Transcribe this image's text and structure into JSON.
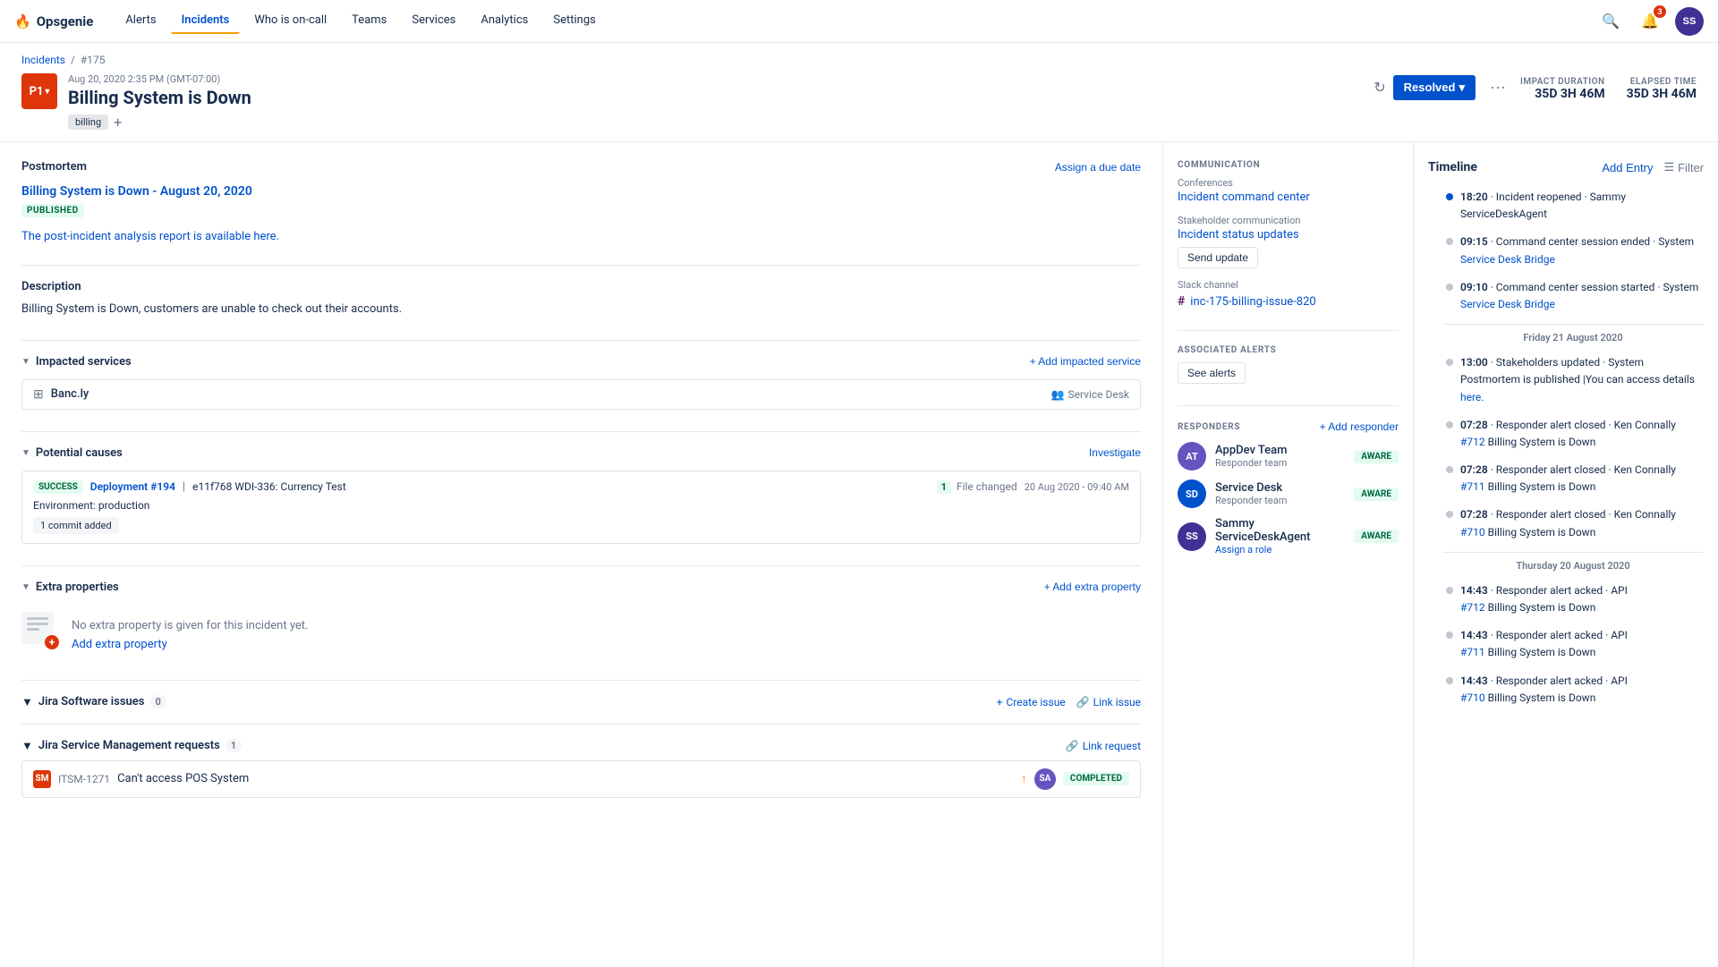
{
  "app": {
    "logo": "🔥",
    "name": "Opsgenie"
  },
  "nav": {
    "links": [
      {
        "label": "Alerts",
        "active": false
      },
      {
        "label": "Incidents",
        "active": true
      },
      {
        "label": "Who is on-call",
        "active": false
      },
      {
        "label": "Teams",
        "active": false
      },
      {
        "label": "Services",
        "active": false
      },
      {
        "label": "Analytics",
        "active": false
      },
      {
        "label": "Settings",
        "active": false
      }
    ],
    "notification_count": "3",
    "avatar_initials": "SS"
  },
  "breadcrumb": {
    "parent": "Incidents",
    "current": "#175"
  },
  "incident": {
    "priority": "P1",
    "date": "Aug 20, 2020 2:35 PM (GMT-07:00)",
    "title": "Billing System is Down",
    "tag": "billing",
    "status": "Resolved",
    "impact_duration_label": "IMPACT DURATION",
    "impact_duration": "35D 3H 46M",
    "elapsed_time_label": "ELAPSED TIME",
    "elapsed_time": "35D 3H 46M"
  },
  "postmortem": {
    "section_title": "Postmortem",
    "assign_due": "Assign a due date",
    "link_text": "Billing System is Down - August 20, 2020",
    "published_badge": "PUBLISHED",
    "description": "The post-incident analysis report is available here."
  },
  "description": {
    "section_title": "Description",
    "text": "Billing System is Down, customers are unable to check out their accounts."
  },
  "impacted_services": {
    "section_title": "Impacted services",
    "add_label": "+ Add impacted service",
    "services": [
      {
        "name": "Banc.ly",
        "team": "Service Desk"
      }
    ]
  },
  "potential_causes": {
    "section_title": "Potential causes",
    "investigate_label": "Investigate",
    "causes": [
      {
        "status": "SUCCESS",
        "deployment": "Deployment #194",
        "description": "e11f768 WDI-336: Currency Test",
        "file_count": "1",
        "file_changed": "File changed",
        "date": "20 Aug 2020 - 09:40 AM",
        "environment": "production",
        "commit": "1 commit added"
      }
    ]
  },
  "extra_properties": {
    "section_title": "Extra properties",
    "add_label": "+ Add extra property",
    "placeholder_text": "No extra property is given for this incident yet.",
    "add_inline": "Add extra property"
  },
  "jira_issues": {
    "section_title": "Jira Software issues",
    "count": "0",
    "create_label": "Create issue",
    "link_label": "Link issue"
  },
  "jira_service_mgmt": {
    "section_title": "Jira Service Management requests",
    "count": "1",
    "link_label": "Link request",
    "requests": [
      {
        "key": "ITSM-1271",
        "title": "Can't access POS System",
        "status": "COMPLETED",
        "priority": "↑"
      }
    ]
  },
  "communication": {
    "label": "COMMUNICATION",
    "conferences_label": "Conferences",
    "conference_link": "Incident command center",
    "stakeholder_label": "Stakeholder communication",
    "stakeholder_link": "Incident status updates",
    "send_update": "Send update",
    "slack_label": "Slack channel",
    "slack_channel": "inc-175-billing-issue-820"
  },
  "associated_alerts": {
    "label": "ASSOCIATED ALERTS",
    "see_alerts": "See alerts"
  },
  "responders": {
    "label": "RESPONDERS",
    "add_label": "+ Add responder",
    "list": [
      {
        "initials": "AT",
        "name": "AppDev Team",
        "role": "Responder team",
        "status": "AWARE"
      },
      {
        "initials": "SD",
        "name": "Service Desk",
        "role": "Responder team",
        "status": "AWARE"
      },
      {
        "initials": "SS",
        "name": "Sammy ServiceDeskAgent",
        "role": "Assign a role",
        "status": "AWARE"
      }
    ]
  },
  "timeline": {
    "title": "Timeline",
    "add_entry": "Add Entry",
    "filter": "Filter",
    "entries": [
      {
        "time": "18:20",
        "text": "Incident reopened · Sammy ServiceDeskAgent",
        "dot": "blue"
      },
      {
        "time": "09:15",
        "text": "Command center session ended · System",
        "link": "Service Desk Bridge",
        "dot": "gray"
      },
      {
        "time": "09:10",
        "text": "Command center session started · System",
        "link": "Service Desk Bridge",
        "dot": "gray"
      },
      {
        "date_separator": "Friday 21 August 2020"
      },
      {
        "time": "13:00",
        "text": "Stakeholders updated · System",
        "multiline": "Postmortem is published |You can access details",
        "link": "here.",
        "dot": "gray"
      },
      {
        "time": "07:28",
        "text": "Responder alert closed · Ken Connally",
        "alert_link": "#712",
        "alert_text": "Billing System is Down",
        "dot": "gray"
      },
      {
        "time": "07:28",
        "text": "Responder alert closed · Ken Connally",
        "alert_link": "#711",
        "alert_text": "Billing System is Down",
        "dot": "gray"
      },
      {
        "time": "07:28",
        "text": "Responder alert closed · Ken Connally",
        "alert_link": "#710",
        "alert_text": "Billing System is Down",
        "dot": "gray"
      },
      {
        "date_separator": "Thursday 20 August 2020"
      },
      {
        "time": "14:43",
        "text": "Responder alert acked · API",
        "alert_link": "#712",
        "alert_text": "Billing System is Down",
        "dot": "gray"
      },
      {
        "time": "14:43",
        "text": "Responder alert acked · API",
        "alert_link": "#711",
        "alert_text": "Billing System is Down",
        "dot": "gray"
      },
      {
        "time": "14:43",
        "text": "Responder alert acked · API",
        "alert_link": "#710",
        "alert_text": "Billing System is Down",
        "dot": "gray"
      }
    ]
  }
}
